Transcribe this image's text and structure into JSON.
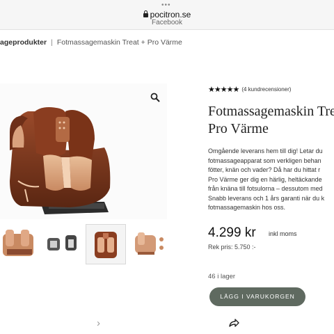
{
  "browser": {
    "dots": "•••",
    "domain": "pocitron.se",
    "subtitle": "Facebook"
  },
  "breadcrumb": {
    "category": "ageprodukter",
    "separator": "|",
    "current": "Fotmassagemaskin Treat + Pro Värme"
  },
  "product": {
    "stars": "★★★★★",
    "reviews": "(4 kundrecensioner)",
    "title_line1": "Fotmassagemaskin Tre",
    "title_line2": "Pro Värme",
    "description": [
      "Omgående leverans hem till dig! Letar du",
      "fotmassageapparat som verkligen behan",
      "fötter, knän och vader? Då har du hittat r",
      "Pro Värme ger dig en härlig, heltäckande",
      "från knäna till fotsulorna – dessutom med",
      "Snabb leverans och 1 års garanti när du k",
      "fotmassagemaskin hos oss."
    ],
    "price": "4.299 kr",
    "price_note": "inkl moms",
    "rek_price": "Rek pris: 5.750 :-",
    "stock": "46 i lager",
    "cart_button": "LÄGG I VARUKORGEN"
  },
  "gallery": {
    "next_arrow": "›",
    "icons": [
      "zoom-icon",
      "chevron-right-icon",
      "share-icon"
    ]
  },
  "colors": {
    "button": "#5f6a60",
    "device_main": "#7a3a22",
    "device_accent": "#d6a27f"
  }
}
